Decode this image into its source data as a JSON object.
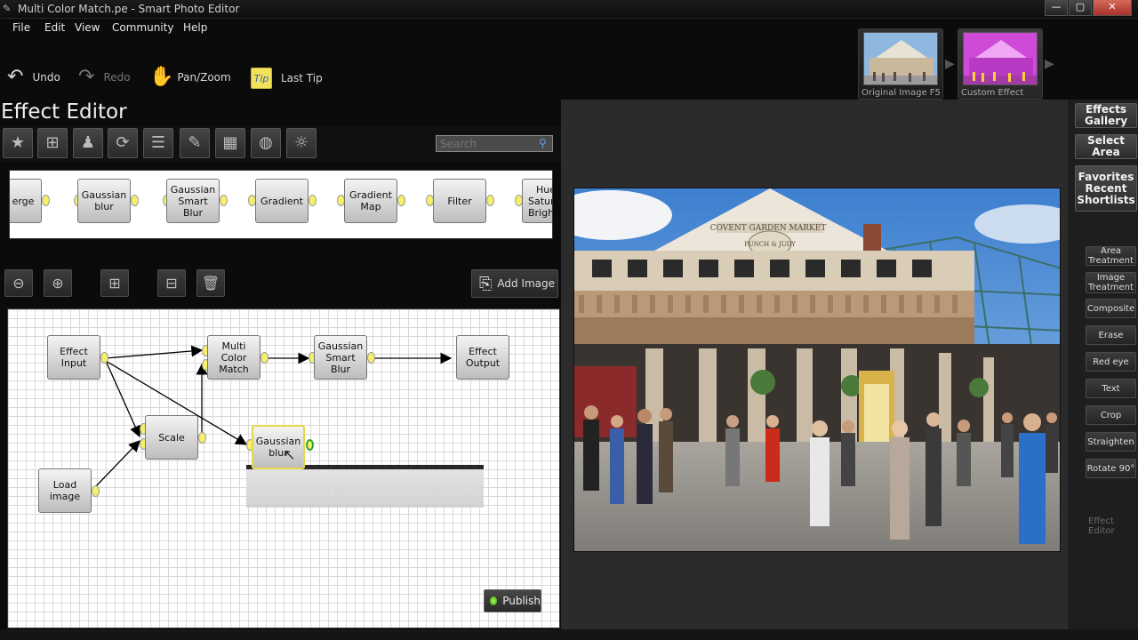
{
  "window": {
    "title": "Multi Color Match.pe - Smart Photo Editor",
    "minimize": "—",
    "maximize": "▢",
    "close": "✕"
  },
  "menu": [
    "File",
    "Edit",
    "View",
    "Community",
    "Help"
  ],
  "toolbar": {
    "undo": "Undo",
    "redo": "Redo",
    "pan_zoom": "Pan/Zoom",
    "last_tip": "Last Tip",
    "tip_badge": "Tip"
  },
  "thumbnails": [
    {
      "label": "Original Image F5"
    },
    {
      "label": "Custom Effect"
    }
  ],
  "effect_editor": {
    "title": "Effect Editor",
    "search_placeholder": "Search",
    "palette": [
      "erge",
      "Gaussian blur",
      "Gaussian Smart Blur",
      "Gradient",
      "Gradient Map",
      "Filter",
      "Hue Saturation Brightness"
    ],
    "add_image": "Add Image",
    "publish": "Publish"
  },
  "graph_nodes": {
    "effect_input": "Effect Input",
    "multi_color_match": "Multi Color Match",
    "gaussian_smart_blur": "Gaussian Smart Blur",
    "effect_output": "Effect Output",
    "scale": "Scale",
    "gaussian_blur": "Gaussian blur",
    "load_image": "Load image"
  },
  "photo": {
    "sign_top": "COVENT GARDEN MARKET",
    "sign_mid": "PUNCH & JUDY"
  },
  "right_panel": {
    "big": [
      "Effects Gallery",
      "Select Area",
      "Favorites Recent Shortlists"
    ],
    "small": [
      "Area Treatment",
      "Image Treatment",
      "Composite",
      "Erase",
      "Red eye",
      "Text",
      "Crop",
      "Straighten",
      "Rotate 90°"
    ],
    "footer": "Effect Editor"
  }
}
